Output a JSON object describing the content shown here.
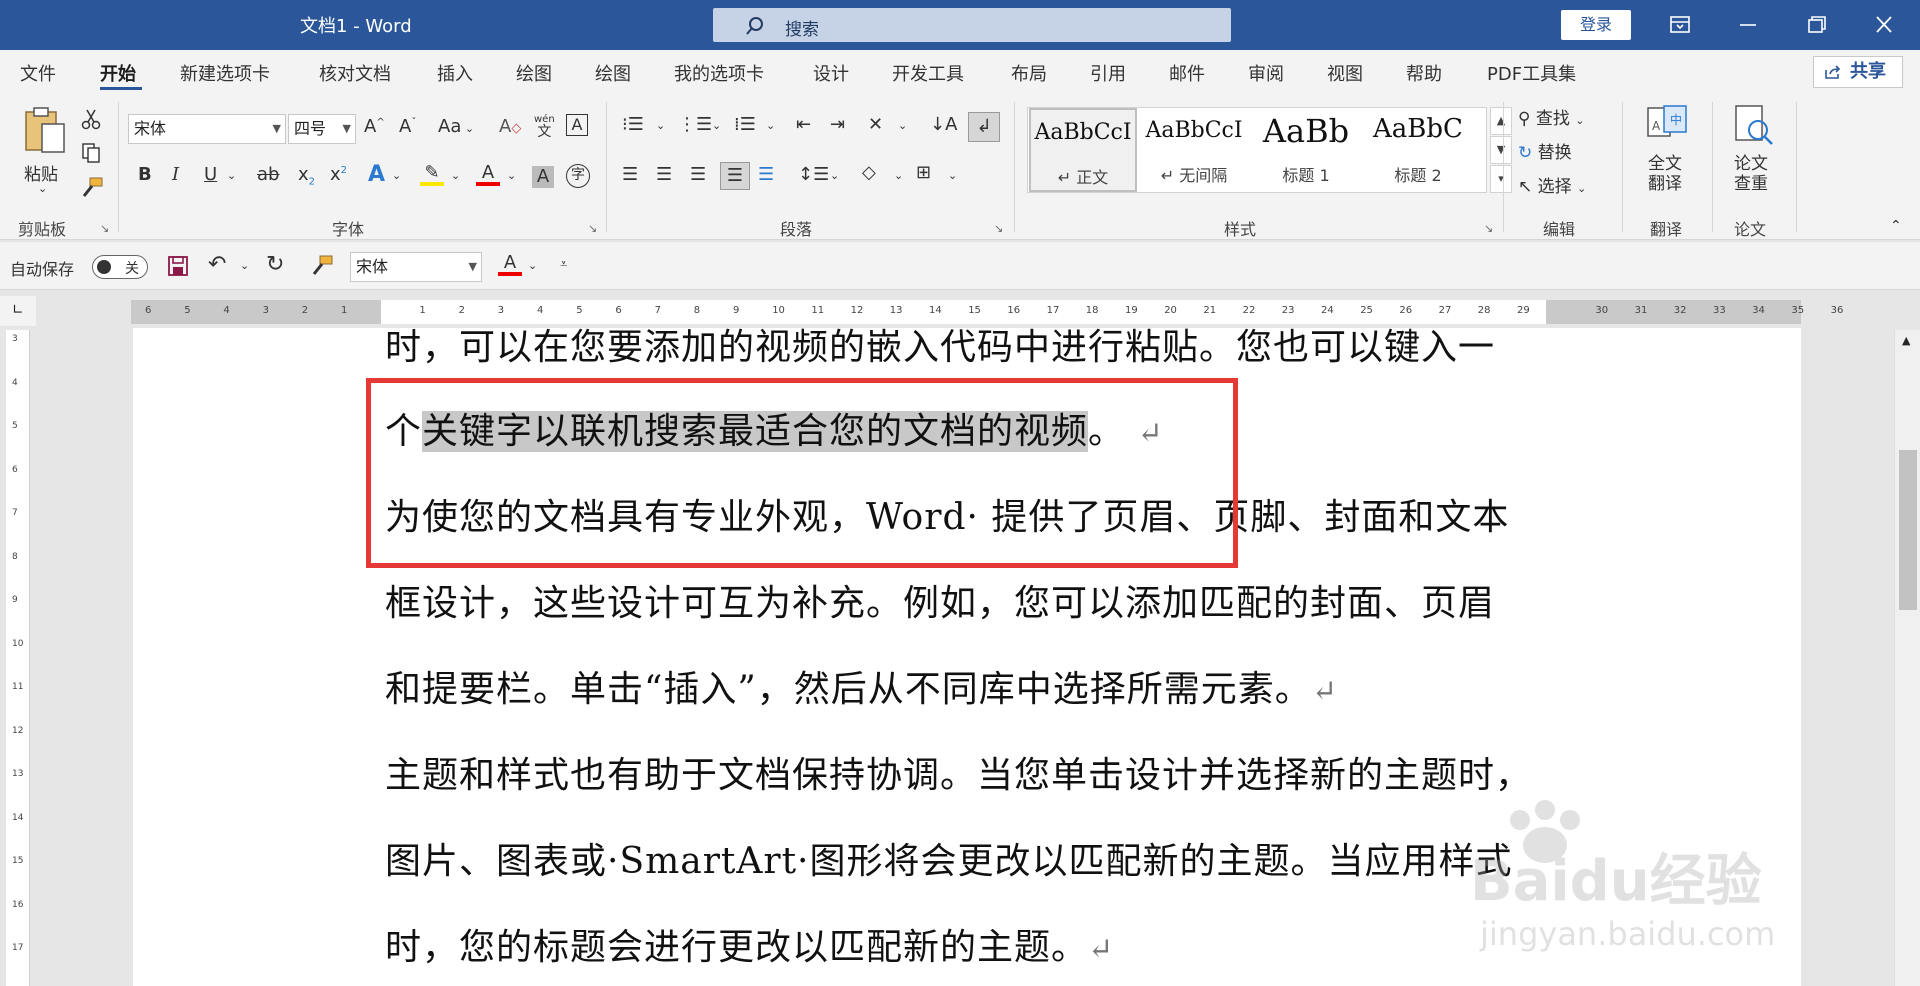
{
  "titlebar": {
    "doc_title": "文档1  -  Word",
    "search_placeholder": "搜索",
    "login_label": "登录"
  },
  "tabs": [
    "文件",
    "开始",
    "新建选项卡",
    "核对文档",
    "插入",
    "绘图",
    "绘图",
    "我的选项卡",
    "设计",
    "开发工具",
    "布局",
    "引用",
    "邮件",
    "审阅",
    "视图",
    "帮助",
    "PDF工具集"
  ],
  "active_tab": "开始",
  "share_label": "共享",
  "ribbon": {
    "clipboard": {
      "paste_label": "粘贴",
      "group_label": "剪贴板"
    },
    "font": {
      "font_name": "宋体",
      "font_size": "四号",
      "group_label": "字体",
      "change_case": "Aa",
      "phonetic": "wén\n文",
      "grow": "A^",
      "shrink": "Aˇ"
    },
    "paragraph": {
      "group_label": "段落"
    },
    "styles": {
      "group_label": "样式",
      "items": [
        {
          "sample": "AaBbCcI",
          "name": "↵ 正文"
        },
        {
          "sample": "AaBbCcI",
          "name": "↵ 无间隔"
        },
        {
          "sample": "AaBb",
          "name": "标题 1"
        },
        {
          "sample": "AaBbC",
          "name": "标题 2"
        }
      ]
    },
    "editing": {
      "find": "查找",
      "replace": "替换",
      "select": "选择",
      "group_label": "编辑"
    },
    "translate": {
      "full_text": "全文\n翻译",
      "group_label": "翻译"
    },
    "paper": {
      "check": "论文\n查重",
      "group_label": "论文"
    }
  },
  "qat": {
    "autosave_label": "自动保存",
    "autosave_state": "关",
    "font_name": "宋体"
  },
  "ruler_numbers": [
    "6",
    "5",
    "4",
    "3",
    "2",
    "1",
    "",
    "1",
    "2",
    "3",
    "4",
    "5",
    "6",
    "7",
    "8",
    "9",
    "10",
    "11",
    "12",
    "13",
    "14",
    "15",
    "16",
    "17",
    "18",
    "19",
    "20",
    "21",
    "22",
    "23",
    "24",
    "25",
    "26",
    "27",
    "28",
    "29",
    "",
    "30",
    "31",
    "32",
    "33",
    "34",
    "35",
    "36"
  ],
  "vruler_numbers": [
    "3",
    "4",
    "5",
    "6",
    "7",
    "8",
    "9",
    "10",
    "11",
    "12",
    "13",
    "14",
    "15",
    "16",
    "17"
  ],
  "document": {
    "line1": "时，可以在您要添加的视频的嵌入代码中进行粘贴。您也可以键入一",
    "line2_prefix": "个",
    "line2_highlight": "关键字以联机搜索最适合您的文档的视频",
    "line2_suffix": "。",
    "line3": "为使您的文档具有专业外观，Word· 提供了页眉、页脚、封面和文本",
    "line4": "框设计，这些设计可互为补充。例如，您可以添加匹配的封面、页眉",
    "line5": "和提要栏。单击“插入”，然后从不同库中选择所需元素。",
    "line6": "主题和样式也有助于文档保持协调。当您单击设计并选择新的主题时，",
    "line7": "图片、图表或·SmartArt·图形将会更改以匹配新的主题。当应用样式",
    "line8": "时，您的标题会进行更改以匹配新的主题。",
    "para_mark": "↵"
  },
  "watermark": {
    "brand": "Baidu经验",
    "url": "jingyan.baidu.com"
  },
  "colors": {
    "title_bar": "#2b579a",
    "highlight_box": "#e53935",
    "selection": "#c8c8c8"
  }
}
